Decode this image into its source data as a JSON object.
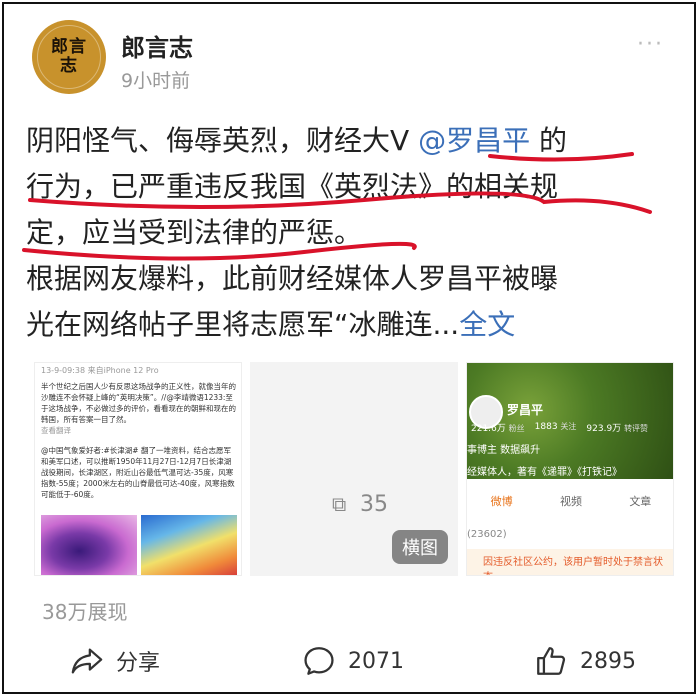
{
  "post": {
    "author": "郎言志",
    "avatar_text": "郎言志",
    "time": "9小时前",
    "more": "···",
    "text": {
      "line1": "阴阳怪气、侮辱英烈，财经大V ",
      "mention": "@罗昌平",
      "line1_end": " 的",
      "line2": "行为，已严重违反我国《英烈法》的相关规",
      "line3": "定，应当受到法律的严惩。",
      "line4": "根据网友爆料，此前财经媒体人罗昌平被曝",
      "line5": "光在网络帖子里将志愿军“冰雕连...",
      "full": "全文"
    },
    "views": "38万展现"
  },
  "images": {
    "img1": {
      "header": "13-9-09:38  来自iPhone 12 Pro",
      "p1": "半个世纪之后国人少有反思这场战争的正义性，就像当年的沙雕连不会怀疑上峰的“英明决策”。//@李靖微语1233:至于这场战争，不必做过多的评价，看看现在的朝鲜和现在的韩国，所有答案一目了然。",
      "p1b": "查看翻译",
      "p2": "@中国气象爱好者:#长津湖# 翻了一堆资料，结合志愿军和美军口述，可以推断1950年11月27日-12月7日长津湖战役期间，长津湖区，附近山谷最低气温可达-35度，风寒指数-55度；2000米左右的山脊最低可达-40度，风寒指数可能低于-60度。"
    },
    "img2": {
      "count": "35",
      "badge": "横图"
    },
    "img3": {
      "name": "罗昌平",
      "followers_num": "221.6万",
      "followers_label": "粉丝",
      "following_num": "1883",
      "following_label": "关注",
      "reposts_num": "923.9万",
      "reposts_label": "转评赞",
      "desc1": "事博主 数据飙升",
      "desc2": "经媒体人，著有《递罪》《打铁记》",
      "tab_weibo": "微博",
      "tab_video": "视频",
      "tab_article": "文章",
      "count": "(23602)",
      "warning": "因违反社区公约，该用户暂时处于禁言状态"
    }
  },
  "actions": {
    "share": "分享",
    "comments": "2071",
    "likes": "2895"
  },
  "colors": {
    "link": "#3b6fb8",
    "underline": "#d9122a",
    "avatar": "#c8922c"
  }
}
